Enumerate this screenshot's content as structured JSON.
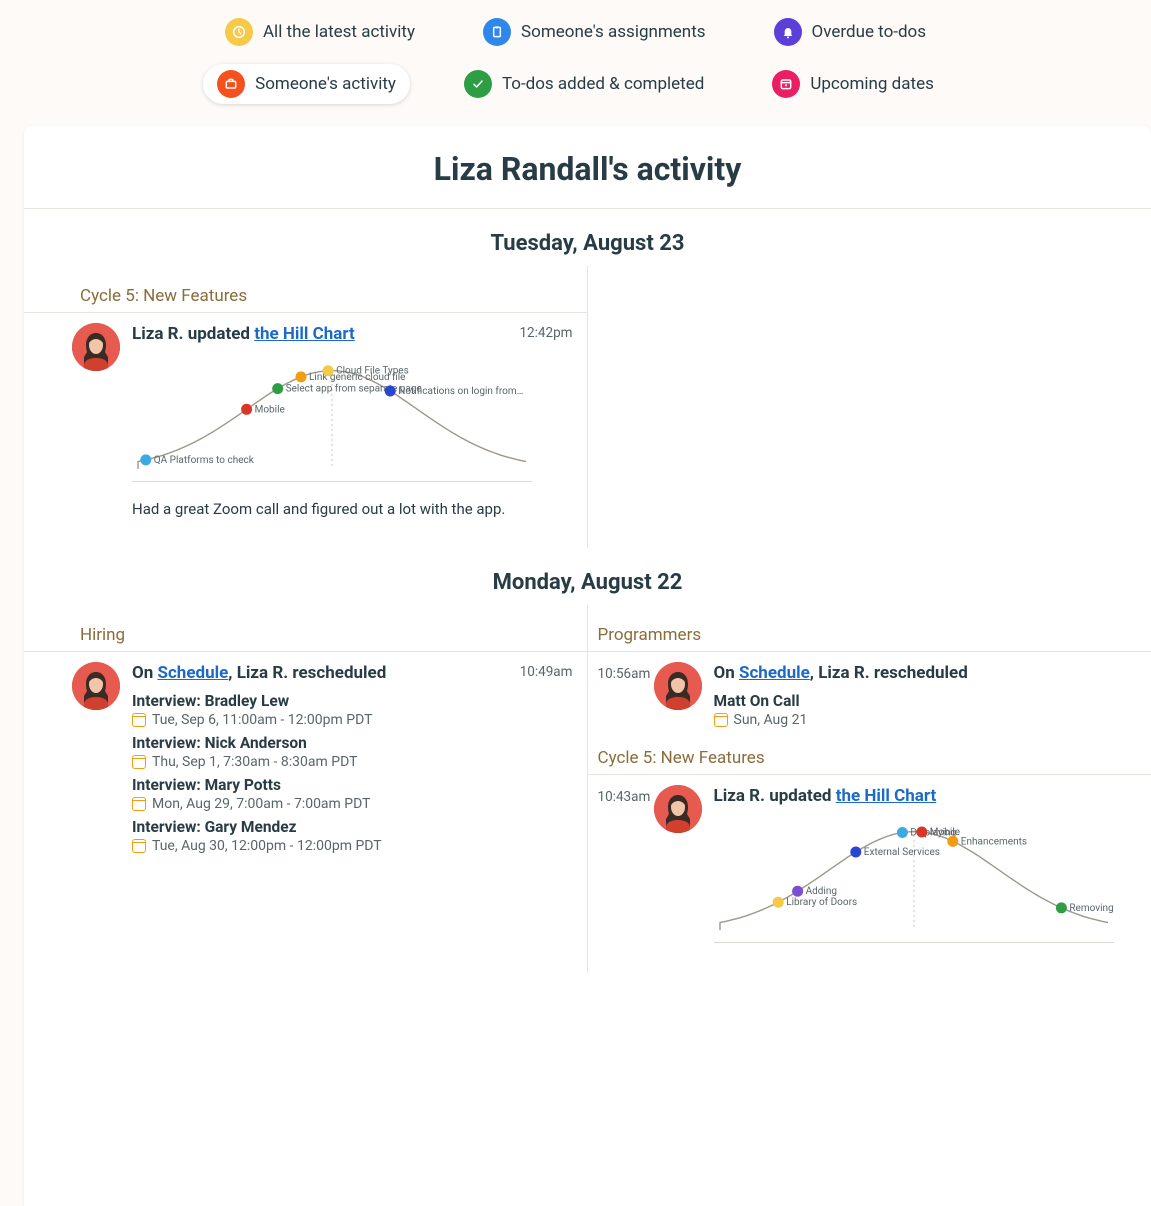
{
  "nav": [
    {
      "label": "All the latest activity",
      "icon": "clock",
      "color": "#f7c948",
      "active": false
    },
    {
      "label": "Someone's assignments",
      "icon": "clipboard",
      "color": "#2f86eb",
      "active": false
    },
    {
      "label": "Overdue to-dos",
      "icon": "bell",
      "color": "#5b3fd9",
      "active": false
    },
    {
      "label": "Someone's activity",
      "icon": "briefcase",
      "color": "#f4511e",
      "active": true
    },
    {
      "label": "To-dos added & completed",
      "icon": "check",
      "color": "#2e9e44",
      "active": false
    },
    {
      "label": "Upcoming dates",
      "icon": "calendar",
      "color": "#e91e63",
      "active": false
    }
  ],
  "page_title": "Liza Randall's activity",
  "user": {
    "short_name": "Liza R."
  },
  "days": [
    {
      "date": "Tuesday, August 23",
      "left": [
        {
          "section": "Cycle 5: New Features",
          "time": "12:42pm",
          "head_prefix": "Liza R. updated ",
          "head_link": "the Hill Chart",
          "note": "Had a great Zoom call and figured out a lot with the app.",
          "hill": "hill1"
        }
      ],
      "right": []
    },
    {
      "date": "Monday, August 22",
      "left": [
        {
          "section": "Hiring",
          "time": "10:49am",
          "head_prefix": "On ",
          "head_link": "Schedule",
          "head_suffix": ", Liza R. rescheduled",
          "items": [
            {
              "title": "Interview: Bradley Lew",
              "date": "Tue, Sep 6, 11:00am - 12:00pm PDT"
            },
            {
              "title": "Interview: Nick Anderson",
              "date": "Thu, Sep 1, 7:30am - 8:30am PDT"
            },
            {
              "title": "Interview: Mary Potts",
              "date": "Mon, Aug 29, 7:00am - 7:00am PDT"
            },
            {
              "title": "Interview: Gary Mendez",
              "date": "Tue, Aug 30, 12:00pm - 12:00pm PDT"
            }
          ]
        }
      ],
      "right": [
        {
          "section": "Programmers",
          "time": "10:56am",
          "head_prefix": "On ",
          "head_link": "Schedule",
          "head_suffix": ", Liza R. rescheduled",
          "items": [
            {
              "title": "Matt On Call",
              "date": "Sun, Aug 21"
            }
          ]
        },
        {
          "section": "Cycle 5: New Features",
          "time": "10:43am",
          "head_prefix": "Liza R. updated ",
          "head_link": "the Hill Chart",
          "hill": "hill2"
        }
      ]
    }
  ],
  "chart_data": [
    {
      "id": "hill1",
      "type": "hill",
      "points": [
        {
          "label": "QA Platforms to check",
          "x": 0.02,
          "color": "#3baae3"
        },
        {
          "label": "Mobile",
          "x": 0.28,
          "color": "#d9362a"
        },
        {
          "label": "Select app from separate page",
          "x": 0.36,
          "color": "#2e9e44"
        },
        {
          "label": "Link generic cloud file",
          "x": 0.42,
          "color": "#f39c12"
        },
        {
          "label": "Cloud File Types",
          "x": 0.49,
          "color": "#f7c948"
        },
        {
          "label": "Notifications on login from…",
          "x": 0.65,
          "color": "#2846d1"
        }
      ]
    },
    {
      "id": "hill2",
      "type": "hill",
      "points": [
        {
          "label": "Library of Doors",
          "x": 0.15,
          "color": "#f7c948"
        },
        {
          "label": "Adding",
          "x": 0.2,
          "color": "#7b4fd1"
        },
        {
          "label": "External Services",
          "x": 0.35,
          "color": "#2846d1"
        },
        {
          "label": "Displaying",
          "x": 0.47,
          "color": "#3baae3"
        },
        {
          "label": "Mobile",
          "x": 0.52,
          "color": "#d9362a"
        },
        {
          "label": "Enhancements",
          "x": 0.6,
          "color": "#f39c12"
        },
        {
          "label": "Removing",
          "x": 0.88,
          "color": "#2e9e44"
        }
      ]
    }
  ]
}
